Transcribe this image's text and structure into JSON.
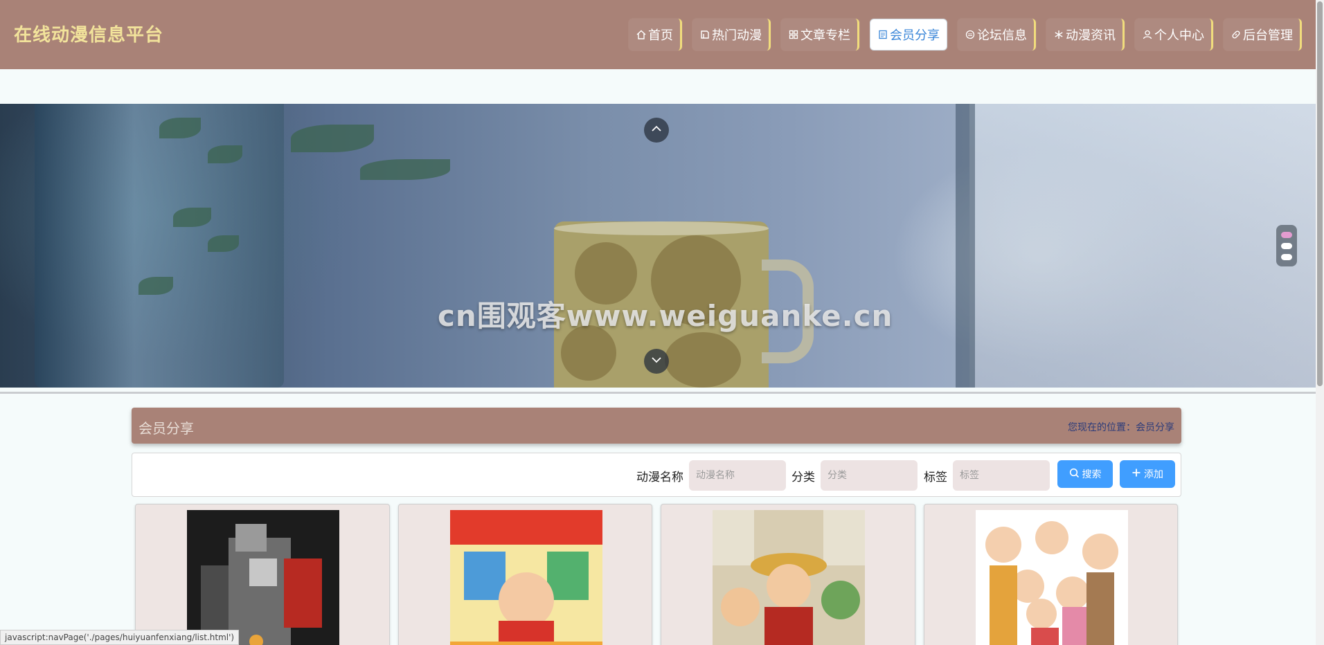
{
  "header": {
    "site_title": "在线动漫信息平台",
    "nav": [
      {
        "label": "首页",
        "icon": "home-icon"
      },
      {
        "label": "热门动漫",
        "icon": "book-icon"
      },
      {
        "label": "文章专栏",
        "icon": "grid-icon"
      },
      {
        "label": "会员分享",
        "icon": "document-icon",
        "active": true
      },
      {
        "label": "论坛信息",
        "icon": "message-icon"
      },
      {
        "label": "动漫资讯",
        "icon": "snowflake-icon"
      },
      {
        "label": "个人中心",
        "icon": "user-icon"
      },
      {
        "label": "后台管理",
        "icon": "link-icon"
      }
    ]
  },
  "banner": {
    "watermark": "cn围观客www.weiguanke.cn",
    "active_slide": 1,
    "slide_count": 3
  },
  "section": {
    "title": "会员分享",
    "breadcrumb": "您现在的位置：会员分享"
  },
  "search": {
    "name_label": "动漫名称",
    "name_placeholder": "动漫名称",
    "category_label": "分类",
    "category_placeholder": "分类",
    "tag_label": "标签",
    "tag_placeholder": "标签",
    "search_button": "搜索",
    "add_button": "添加"
  },
  "cards": [
    {
      "image": "robot-figure"
    },
    {
      "image": "crayon-shinchan-poster"
    },
    {
      "image": "one-piece-poster"
    },
    {
      "image": "chibi-maruko-family"
    }
  ],
  "status_bar": "javascript:navPage('./pages/huiyuanfenxiang/list.html')",
  "colors": {
    "header_bg": "#a98277",
    "title_color": "#f2e39b",
    "nav_accent": "#f1dd7c",
    "active_text": "#3a86d8",
    "button_blue": "#409eff",
    "input_bg": "#ede3e3"
  }
}
